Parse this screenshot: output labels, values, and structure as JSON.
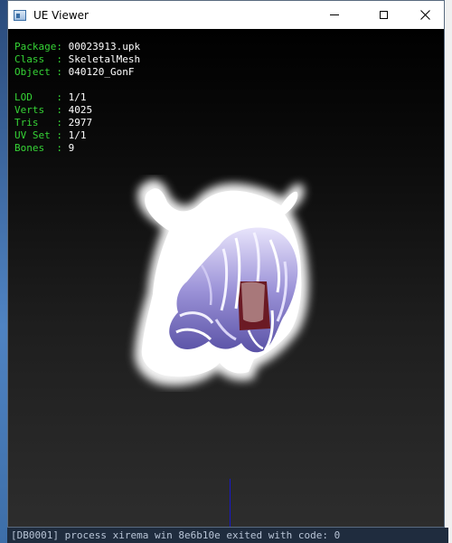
{
  "window": {
    "title": "UE Viewer",
    "icons": {
      "app": "app-window-icon",
      "minimize": "minimize-icon",
      "maximize": "maximize-icon",
      "close": "close-icon"
    }
  },
  "info": {
    "package": {
      "key": "Package: ",
      "value": "00023913.upk"
    },
    "class": {
      "key": "Class  : ",
      "value": "SkeletalMesh"
    },
    "object": {
      "key": "Object : ",
      "value": "040120_GonF"
    },
    "lod": {
      "key": "LOD    : ",
      "value": "1/1"
    },
    "verts": {
      "key": "Verts  : ",
      "value": "4025"
    },
    "tris": {
      "key": "Tris   : ",
      "value": "2977"
    },
    "uvset": {
      "key": "UV Set : ",
      "value": "1/1"
    },
    "bones": {
      "key": "Bones  : ",
      "value": "9"
    }
  },
  "background": {
    "console_bottom_text": "[DB0001] process  xirema win 8e6b10e  exited with code: 0"
  },
  "colors": {
    "label_green": "#36d436",
    "value_white": "#ffffff",
    "axis_blue": "#1818c8"
  }
}
